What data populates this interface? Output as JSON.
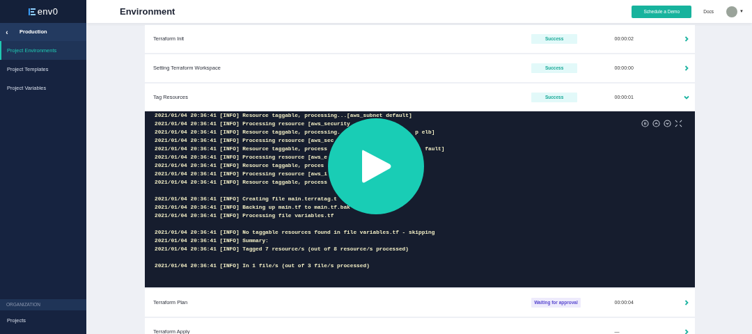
{
  "logo": {
    "text": "env0"
  },
  "sidebar": {
    "back": {
      "arrow": "‹",
      "label": "Production"
    },
    "items": [
      {
        "label": "Project Environments",
        "selected": true
      },
      {
        "label": "Project Templates",
        "selected": false
      },
      {
        "label": "Project Variables",
        "selected": false
      }
    ],
    "section": {
      "title": "ORGANIZATION",
      "items": [
        {
          "label": "Projects",
          "selected": false
        }
      ]
    }
  },
  "header": {
    "title": "Environment",
    "button": "Schedule a Demo",
    "link": "Docs",
    "menu_caret": "▼"
  },
  "steps": [
    {
      "name": "Terraform Init",
      "status": {
        "label": "Success",
        "kind": "success"
      },
      "duration": "00:00:02",
      "expanded": false
    },
    {
      "name": "Setting Terraform Workspace",
      "status": {
        "label": "Success",
        "kind": "success"
      },
      "duration": "00:00:00",
      "expanded": false
    },
    {
      "name": "Tag Resources",
      "status": {
        "label": "Success",
        "kind": "success"
      },
      "duration": "00:00:01",
      "expanded": true,
      "log": [
        {
          "kind": "line",
          "text": "2021/01/04 20:36:41 [INFO] Resource taggable, processing...[aws_subnet default]"
        },
        {
          "kind": "line",
          "text": "2021/01/04 20:36:41 [INFO] Processing resource [aws_security"
        },
        {
          "kind": "line",
          "text": "2021/01/04 20:36:41 [INFO] Resource taggable, processing.",
          "tail": "p elb]"
        },
        {
          "kind": "line",
          "text": "2021/01/04 20:36:41 [INFO] Processing resource [aws_sec"
        },
        {
          "kind": "line",
          "text": "2021/01/04 20:36:41 [INFO] Resource taggable, process",
          "tail": "fault]"
        },
        {
          "kind": "line",
          "text": "2021/01/04 20:36:41 [INFO] Processing resource [aws_e"
        },
        {
          "kind": "line",
          "text": "2021/01/04 20:36:41 [INFO] Resource taggable, proces"
        },
        {
          "kind": "line",
          "text": "2021/01/04 20:36:41 [INFO] Processing resource [aws_i"
        },
        {
          "kind": "line",
          "text": "2021/01/04 20:36:41 [INFO] Resource taggable, process"
        },
        {
          "kind": "gap"
        },
        {
          "kind": "line",
          "text": "2021/01/04 20:36:41 [INFO] Creating file main.terratag.t"
        },
        {
          "kind": "line",
          "text": "2021/01/04 20:36:41 [INFO] Backing up main.tf to main.tf.bak"
        },
        {
          "kind": "line",
          "text": "2021/01/04 20:36:41 [INFO] Processing file variables.tf"
        },
        {
          "kind": "gap"
        },
        {
          "kind": "line",
          "text": "2021/01/04 20:36:41 [INFO] No taggable resources found in file variables.tf - skipping"
        },
        {
          "kind": "line",
          "text": "2021/01/04 20:36:41 [INFO] Summary:"
        },
        {
          "kind": "line",
          "text": "2021/01/04 20:36:41 [INFO] Tagged 7 resource/s (out of 8 resource/s processed)"
        },
        {
          "kind": "gap"
        },
        {
          "kind": "line",
          "text": "2021/01/04 20:36:41 [INFO] In 1 file/s (out of 3 file/s processed)"
        }
      ]
    },
    {
      "name": "Terraform Plan",
      "status": {
        "label": "Waiting for approval",
        "kind": "waiting"
      },
      "duration": "00:00:04",
      "expanded": false
    },
    {
      "name": "Terraform Apply",
      "duration": "—",
      "expanded": false
    }
  ]
}
